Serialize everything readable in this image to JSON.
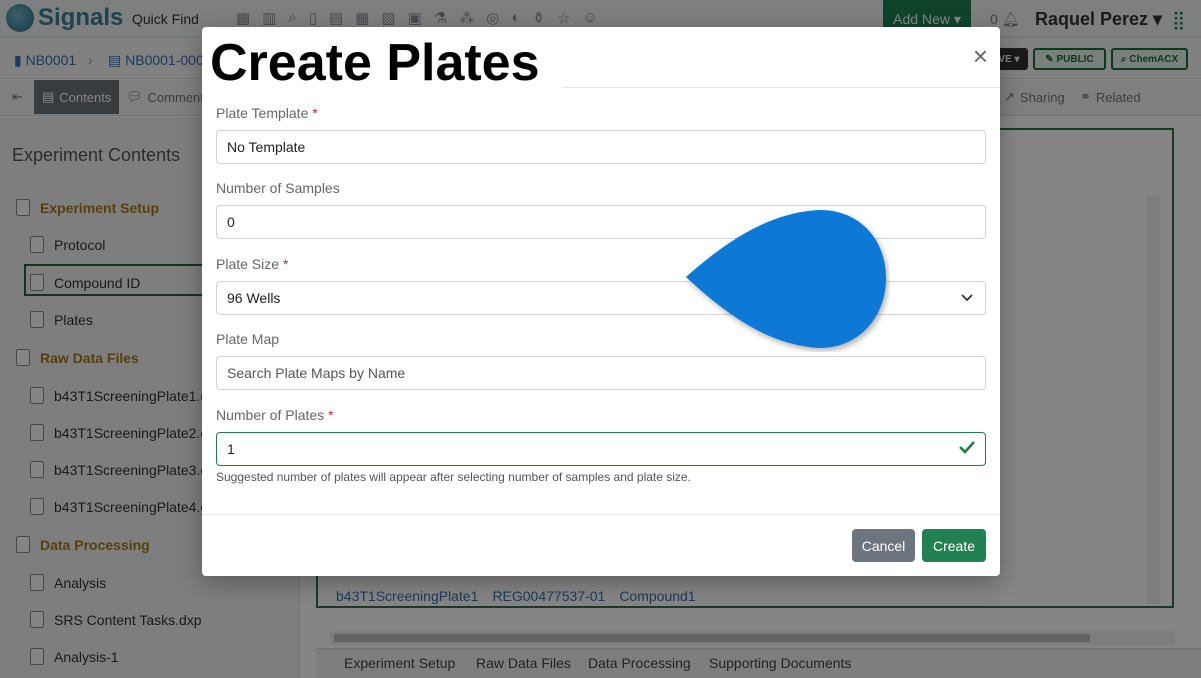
{
  "app": {
    "logo": "Signals",
    "quick_find": "Quick Find",
    "add_new": "Add New ▾",
    "notifications": "0",
    "user": "Raquel Perez ▾"
  },
  "breadcrumbs": [
    "NB0001",
    "NB0001-000"
  ],
  "badges": {
    "save": "VE ▾",
    "public": "PUBLIC",
    "chemacx": "ChemACX"
  },
  "toolbar": {
    "contents": "Contents",
    "comments": "Comment",
    "sharing": "Sharing",
    "related": "Related"
  },
  "panel": {
    "title": "Experiment Contents",
    "items": [
      {
        "label": "Experiment Setup",
        "section": true
      },
      {
        "label": "Protocol",
        "section": false
      },
      {
        "label": "Compound ID",
        "section": false
      },
      {
        "label": "Plates",
        "section": false
      },
      {
        "label": "Raw Data Files",
        "section": true
      },
      {
        "label": "b43T1ScreeningPlate1.c",
        "section": false
      },
      {
        "label": "b43T1ScreeningPlate2.c",
        "section": false
      },
      {
        "label": "b43T1ScreeningPlate3.c",
        "section": false
      },
      {
        "label": "b43T1ScreeningPlate4.c",
        "section": false
      },
      {
        "label": "Data Processing",
        "section": true
      },
      {
        "label": "Analysis",
        "section": false
      },
      {
        "label": "SRS Content Tasks.dxp",
        "section": false
      },
      {
        "label": "Analysis-1",
        "section": false
      }
    ]
  },
  "table_peek": [
    "b43T1ScreeningPlate1",
    "REG00477537-01",
    "Compound1"
  ],
  "bottom_tabs": [
    "Experiment Setup",
    "Raw Data Files",
    "Data Processing",
    "Supporting Documents"
  ],
  "modal": {
    "title": "Create Plates",
    "close": "×",
    "plate_template": {
      "label": "Plate Template",
      "value": "No Template"
    },
    "num_samples": {
      "label": "Number of Samples",
      "value": "0"
    },
    "plate_size": {
      "label": "Plate Size",
      "value": "96 Wells"
    },
    "plate_map": {
      "label": "Plate Map",
      "placeholder": "Search Plate Maps by Name"
    },
    "num_plates": {
      "label": "Number of Plates",
      "value": "1"
    },
    "help": "Suggested number of plates will appear after selecting number of samples and plate size.",
    "cancel": "Cancel",
    "create": "Create"
  },
  "colors": {
    "accent": "#228153",
    "pin": "#0a78d6"
  }
}
